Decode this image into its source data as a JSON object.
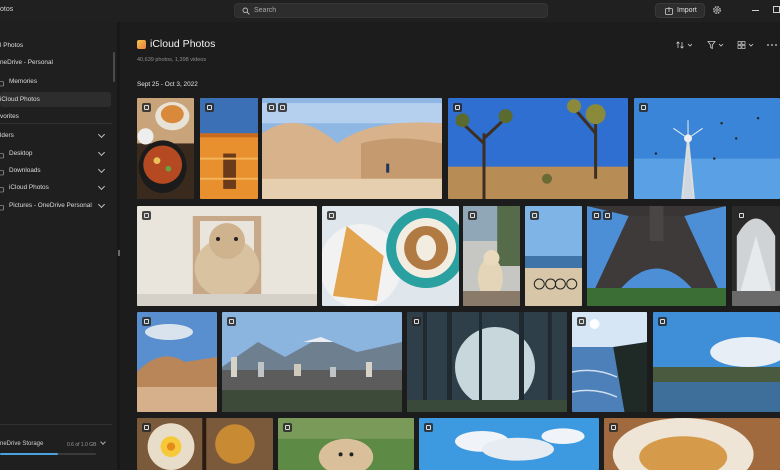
{
  "titlebar": {
    "app_name": "otos",
    "search_placeholder": "Search",
    "import_label": "Import"
  },
  "sidebar": {
    "items": [
      {
        "label": "l Photos",
        "indent": false,
        "chevron": false,
        "selected": false
      },
      {
        "label": "neDrive - Personal",
        "indent": false,
        "chevron": false,
        "selected": false
      },
      {
        "label": "Memories",
        "indent": true,
        "chevron": false,
        "selected": false
      },
      {
        "label": "iCloud Photos",
        "indent": false,
        "chevron": false,
        "selected": true
      },
      {
        "label": "vorites",
        "indent": false,
        "chevron": false,
        "selected": false
      },
      {
        "label": "lders",
        "indent": false,
        "chevron": true,
        "selected": false
      },
      {
        "label": "Desktop",
        "indent": true,
        "chevron": true,
        "selected": false
      },
      {
        "label": "Downloads",
        "indent": true,
        "chevron": true,
        "selected": false
      },
      {
        "label": "iCloud Photos",
        "indent": true,
        "chevron": true,
        "selected": false
      },
      {
        "label": "Pictures - OneDrive Personal",
        "indent": true,
        "chevron": true,
        "selected": false
      }
    ],
    "storage": {
      "label": "neDrive Storage",
      "value": "0.6 of 1.0 GB",
      "fraction": 0.6
    }
  },
  "main": {
    "title": "iCloud Photos",
    "subtitle": "40,639 photos, 1,398 videos",
    "date_range": "Sept 25 - Oct 3, 2022",
    "toolbar": [
      "sort-icon",
      "filter-icon",
      "view-icon",
      "more-icon"
    ]
  },
  "photos": [
    {
      "name": "photo-food-plates",
      "scene": "food"
    },
    {
      "name": "photo-orange-wall",
      "scene": "orange"
    },
    {
      "name": "photo-desert-rocks",
      "scene": "rocks"
    },
    {
      "name": "photo-joshua-trees",
      "scene": "joshua"
    },
    {
      "name": "photo-tower-birds",
      "scene": "tower"
    },
    {
      "name": "photo-dog-chair",
      "scene": "dog"
    },
    {
      "name": "photo-toast-latte",
      "scene": "latte"
    },
    {
      "name": "photo-dog-street",
      "scene": "dogstreet"
    },
    {
      "name": "photo-bikes-beach",
      "scene": "bikes"
    },
    {
      "name": "photo-eiffel-tower",
      "scene": "eiffel"
    },
    {
      "name": "photo-louvre",
      "scene": "louvre"
    },
    {
      "name": "photo-desert-hike",
      "scene": "hike"
    },
    {
      "name": "photo-city-mountains",
      "scene": "city"
    },
    {
      "name": "photo-forest-sunbeams",
      "scene": "forest"
    },
    {
      "name": "photo-ocean-cliff",
      "scene": "ocean"
    },
    {
      "name": "photo-lake-clouds",
      "scene": "lake"
    },
    {
      "name": "photo-brunch",
      "scene": "brunch"
    },
    {
      "name": "photo-dog-grass",
      "scene": "doggrass"
    },
    {
      "name": "photo-sky-clouds",
      "scene": "sky"
    },
    {
      "name": "photo-dessert",
      "scene": "dessert"
    }
  ]
}
